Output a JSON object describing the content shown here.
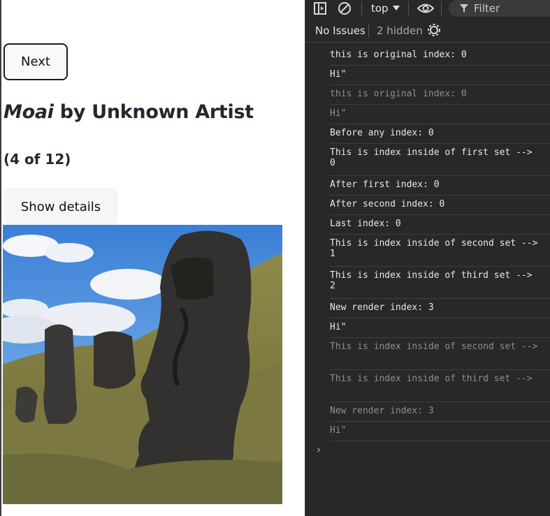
{
  "app": {
    "next_label": "Next",
    "title_italic": "Moai",
    "title_rest": " by Unknown Artist",
    "counter": "(4 of 12)",
    "details_label": "Show details"
  },
  "devtools": {
    "context": "top",
    "filter_placeholder": "Filter",
    "issues": "No Issues",
    "hidden": "2 hidden",
    "logs": [
      {
        "text": "this is original index: 0",
        "dim": false
      },
      {
        "text": "Hi\"",
        "dim": false
      },
      {
        "text": "this is original index: 0",
        "dim": true
      },
      {
        "text": "Hi\"",
        "dim": true
      },
      {
        "text": "Before any index: 0",
        "dim": false
      },
      {
        "text": "This is index inside of first set -->\n0",
        "dim": false
      },
      {
        "text": "After first index: 0",
        "dim": false
      },
      {
        "text": "After second index: 0",
        "dim": false
      },
      {
        "text": "Last index: 0",
        "dim": false
      },
      {
        "text": "This is index inside of second set -->\n1",
        "dim": false
      },
      {
        "text": "This is index inside of third set -->\n2",
        "dim": false
      },
      {
        "text": "New render index: 3",
        "dim": false
      },
      {
        "text": "Hi\"",
        "dim": false
      },
      {
        "text": "This is index inside of second set -->\n",
        "dim": true
      },
      {
        "text": "This is index inside of third set -->\n",
        "dim": true
      },
      {
        "text": "New render index: 3",
        "dim": true
      },
      {
        "text": "Hi\"",
        "dim": true
      }
    ],
    "prompt_symbol": "›"
  }
}
